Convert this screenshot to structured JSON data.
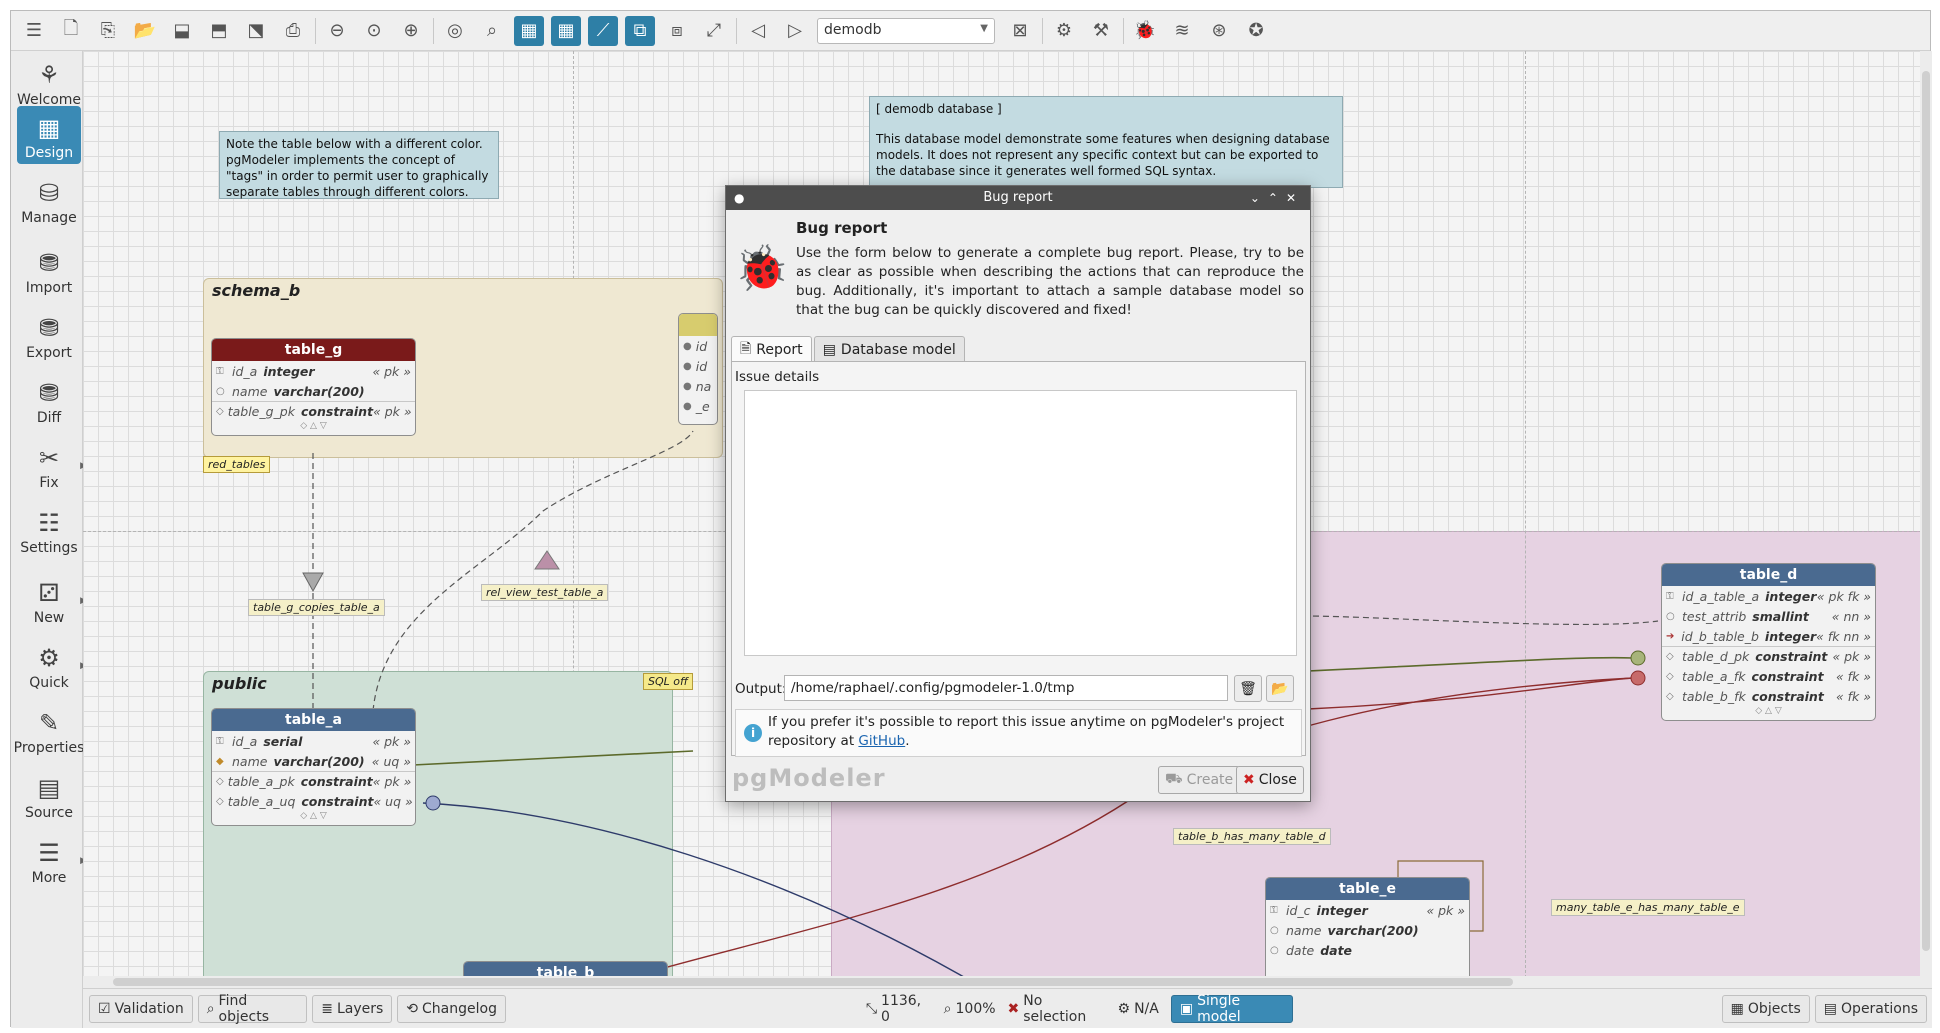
{
  "toolbar": {
    "database_select": "demodb"
  },
  "sidebar": {
    "items": [
      {
        "label": "Welcome",
        "icon": "welcome-icon"
      },
      {
        "label": "Design",
        "icon": "design-icon"
      },
      {
        "label": "Manage",
        "icon": "manage-icon"
      },
      {
        "label": "Import",
        "icon": "import-icon"
      },
      {
        "label": "Export",
        "icon": "export-icon"
      },
      {
        "label": "Diff",
        "icon": "diff-icon"
      },
      {
        "label": "Fix",
        "icon": "fix-icon"
      },
      {
        "label": "Settings",
        "icon": "settings-icon"
      },
      {
        "label": "New",
        "icon": "new-icon"
      },
      {
        "label": "Quick",
        "icon": "quick-icon"
      },
      {
        "label": "Properties",
        "icon": "properties-icon"
      },
      {
        "label": "Source",
        "icon": "source-icon"
      },
      {
        "label": "More",
        "icon": "more-icon"
      }
    ]
  },
  "canvas": {
    "note_tags": "Note the table below with a different color. pgModeler implements the concept of \"tags\" in order to permit user to graphically separate tables through different colors.",
    "note_db_title": "[ demodb database ]",
    "note_db_body": "This database model demonstrate some features when designing database models. It does not represent any specific context but can be exported to the database since it generates well formed SQL syntax.",
    "schema_b": "schema_b",
    "public": "public",
    "tag_red": "red_tables",
    "sql_off": "SQL off",
    "rel_labels": {
      "copies": "table_g_copies_table_a",
      "view": "rel_view_test_table_a",
      "has_many_d": "table_b_has_many_table_d",
      "many_e": "many_table_e_has_many_table_e"
    },
    "table_g": {
      "name": "table_g",
      "rows": [
        {
          "n": "id_a",
          "t": "integer",
          "c": "« pk »"
        },
        {
          "n": "name",
          "t": "varchar(200)",
          "c": ""
        },
        {
          "n": "table_g_pk",
          "t": "constraint",
          "c": "« pk »"
        }
      ]
    },
    "table_a": {
      "name": "table_a",
      "rows": [
        {
          "n": "id_a",
          "t": "serial",
          "c": "« pk »"
        },
        {
          "n": "name",
          "t": "varchar(200)",
          "c": "« uq »"
        },
        {
          "n": "table_a_pk",
          "t": "constraint",
          "c": "« pk »"
        },
        {
          "n": "table_a_uq",
          "t": "constraint",
          "c": "« uq »"
        }
      ]
    },
    "table_d": {
      "name": "table_d",
      "rows": [
        {
          "n": "id_a_table_a",
          "t": "integer",
          "c": "« pk fk »"
        },
        {
          "n": "test_attrib",
          "t": "smallint",
          "c": "« nn »"
        },
        {
          "n": "id_b_table_b",
          "t": "integer",
          "c": "« fk nn »"
        },
        {
          "n": "table_d_pk",
          "t": "constraint",
          "c": "« pk »"
        },
        {
          "n": "table_a_fk",
          "t": "constraint",
          "c": "« fk »"
        },
        {
          "n": "table_b_fk",
          "t": "constraint",
          "c": "« fk »"
        }
      ]
    },
    "table_e": {
      "name": "table_e",
      "rows": [
        {
          "n": "id_c",
          "t": "integer",
          "c": "« pk »"
        },
        {
          "n": "name",
          "t": "varchar(200)",
          "c": ""
        },
        {
          "n": "date",
          "t": "date",
          "c": ""
        }
      ]
    },
    "table_b": {
      "name": "table_b"
    },
    "partial_rows": [
      "id",
      "id",
      "na",
      "_e"
    ]
  },
  "dialog": {
    "title": "Bug report",
    "heading": "Bug report",
    "description": "Use the form below to generate a complete bug report. Please, try to be as clear as possible when describing the actions that can reproduce the bug. Additionally, it's important to attach a sample database model so that the bug can be quickly discovered and fixed!",
    "tab_report": "Report",
    "tab_model": "Database model",
    "issue_label": "Issue details",
    "issue_value": "",
    "output_label": "Output:",
    "output_value": "/home/raphael/.config/pgmodeler-1.0/tmp",
    "info_text": "If you prefer it's possible to report this issue anytime on pgModeler's project repository at",
    "info_link": "GitHub",
    "info_end": ".",
    "logo": "pgModeler",
    "create_label": "Create",
    "close_label": "Close"
  },
  "statusbar": {
    "validation": "Validation",
    "find": "Find objects",
    "layers": "Layers",
    "changelog": "Changelog",
    "coords": "1136, 0",
    "zoom": "100%",
    "selection": "No selection",
    "na": "N/A",
    "single_model": "Single model",
    "objects": "Objects",
    "operations": "Operations"
  },
  "colors": {
    "accent": "#3a8ab5",
    "table_g_header": "#7a1a1a",
    "table_header": "#4a6a90",
    "schema_b_bg": "#efe8d2",
    "public_bg": "#cfe0d6",
    "pink_bg": "#e6d2e2",
    "dialog_title": "#4d4d4d"
  }
}
